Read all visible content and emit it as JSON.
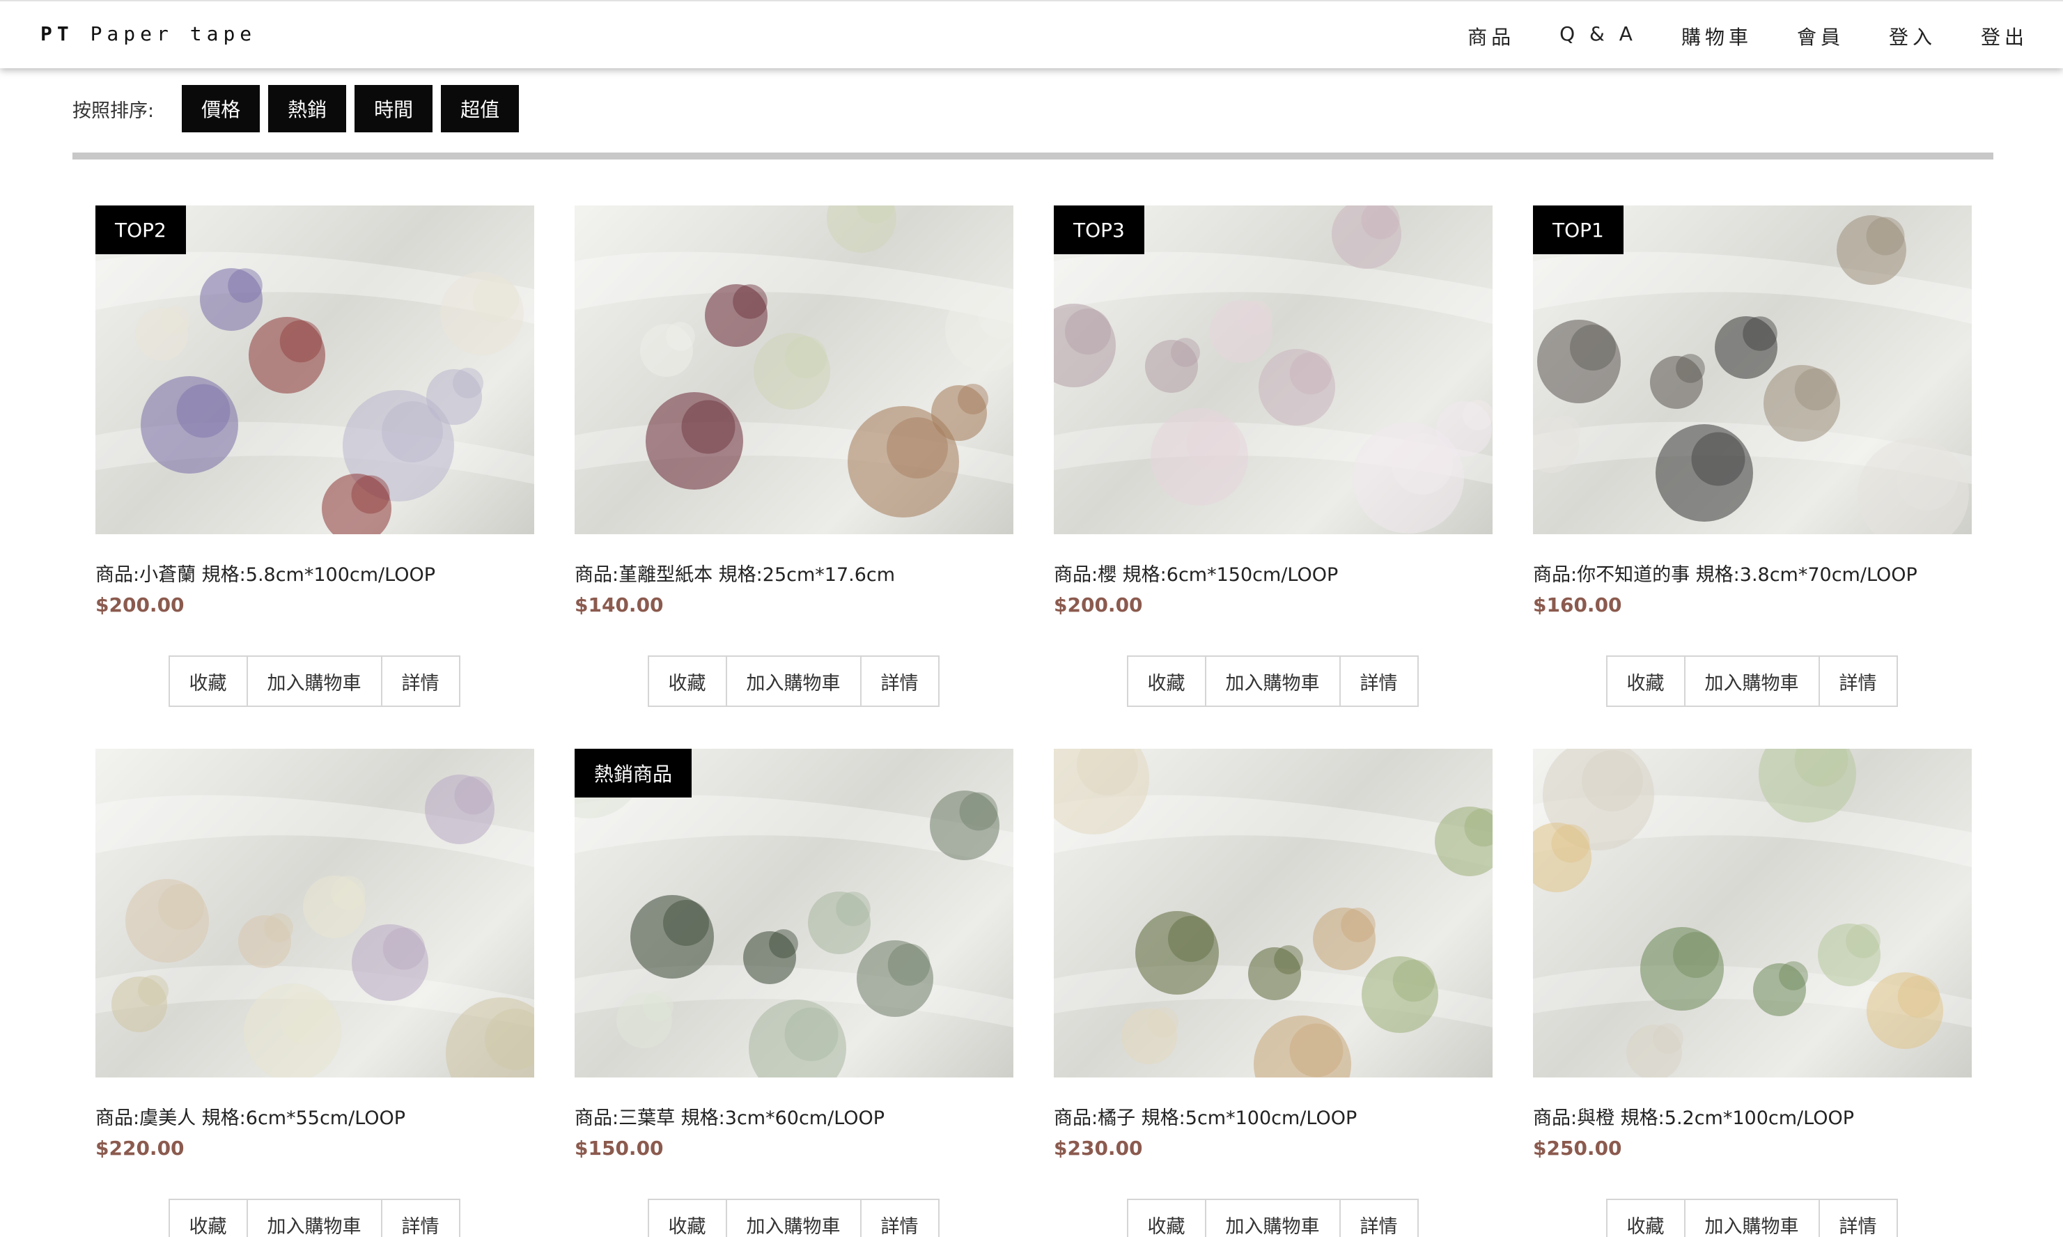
{
  "brand": {
    "bold": "PT",
    "rest": "Paper tape"
  },
  "nav": [
    "商品",
    "Q & A",
    "購物車",
    "會員",
    "登入",
    "登出"
  ],
  "sort": {
    "label": "按照排序:",
    "options": [
      "價格",
      "熱銷",
      "時間",
      "超值"
    ]
  },
  "actions": {
    "favorite": "收藏",
    "add_to_cart": "加入購物車",
    "details": "詳情"
  },
  "products": [
    {
      "tag": "TOP2",
      "name": "商品:小蒼蘭 規格:5.8cm*100cm/LOOP",
      "price": "$200.00"
    },
    {
      "tag": "",
      "name": "商品:堇離型紙本 規格:25cm*17.6cm",
      "price": "$140.00"
    },
    {
      "tag": "TOP3",
      "name": "商品:櫻 規格:6cm*150cm/LOOP",
      "price": "$200.00"
    },
    {
      "tag": "TOP1",
      "name": "商品:你不知道的事 規格:3.8cm*70cm/LOOP",
      "price": "$160.00"
    },
    {
      "tag": "",
      "name": "商品:虞美人 規格:6cm*55cm/LOOP",
      "price": "$220.00"
    },
    {
      "tag": "熱銷商品",
      "name": "商品:三葉草 規格:3cm*60cm/LOOP",
      "price": "$150.00"
    },
    {
      "tag": "",
      "name": "商品:橘子 規格:5cm*100cm/LOOP",
      "price": "$230.00"
    },
    {
      "tag": "",
      "name": "商品:與橙 規格:5.2cm*100cm/LOOP",
      "price": "$250.00"
    }
  ]
}
